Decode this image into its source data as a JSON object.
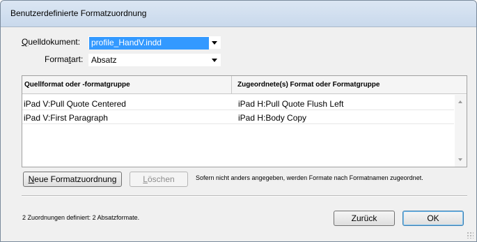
{
  "window": {
    "title": "Benutzerdefinierte Formatzuordnung"
  },
  "form": {
    "source_label_pre": "",
    "source_label_ul": "Q",
    "source_label_post": "uelldokument:",
    "source_value": "profile_HandV.indd",
    "type_label_pre": "Forma",
    "type_label_ul": "t",
    "type_label_post": "art:",
    "type_value": "Absatz"
  },
  "table": {
    "columns": [
      "Quellformat oder -formatgruppe",
      "Zugeordnete(s) Format oder Formatgruppe"
    ],
    "rows": [
      [
        "iPad V:Pull Quote Centered",
        "iPad H:Pull Quote Flush Left"
      ],
      [
        "iPad V:First Paragraph",
        "iPad H:Body Copy"
      ]
    ]
  },
  "buttons": {
    "new_mapping_ul": "N",
    "new_mapping_rest": "eue Formatzuordnung",
    "delete_ul": "L",
    "delete_rest": "öschen",
    "back": "Zurück",
    "ok": "OK"
  },
  "info_note": "Sofern nicht anders angegeben, werden Formate nach Formatnamen zugeordnet.",
  "status": "2 Zuordnungen definiert:  2 Absatzformate.",
  "icons": [
    "dropdown-arrow-icon",
    "scroll-up-icon",
    "scroll-down-icon",
    "resize-grip-icon"
  ]
}
